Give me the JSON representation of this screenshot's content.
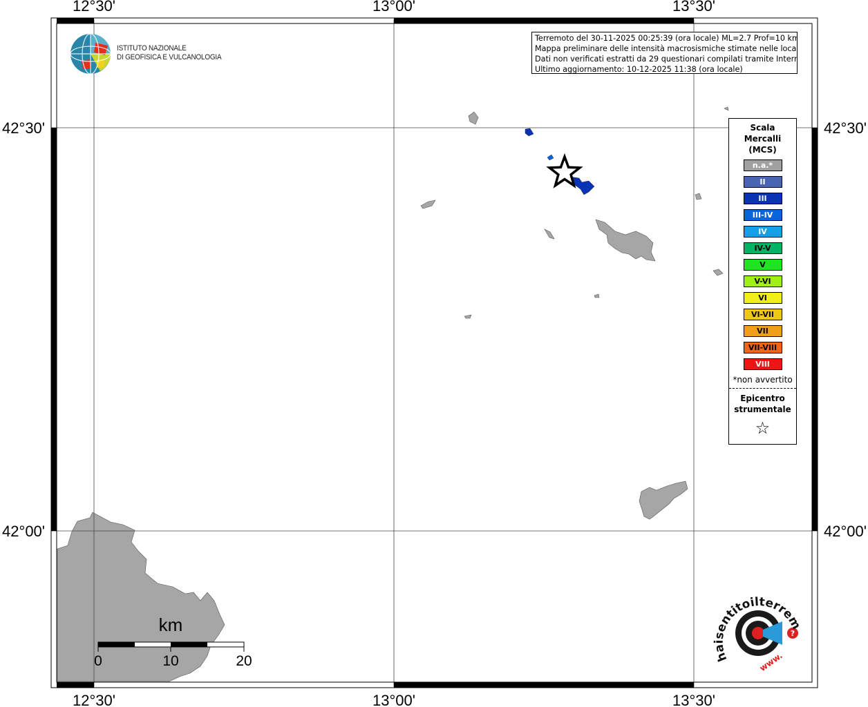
{
  "coords": {
    "top": [
      "12°30'",
      "13°00'",
      "13°30'"
    ],
    "bottom": [
      "12°30'",
      "13°00'",
      "13°30'"
    ],
    "left": [
      "42°30'",
      "42°00'"
    ],
    "right": [
      "42°30'",
      "42°00'"
    ]
  },
  "ingv": {
    "line1": "ISTITUTO NAZIONALE",
    "line2": "DI GEOFISICA E VULCANOLOGIA"
  },
  "info": {
    "line1": "Terremoto del 30-11-2025 00:25:39 (ora locale) ML=2.7 Prof=10 km",
    "line2": "Mappa preliminare delle intensità macrosismiche stimate nelle località",
    "line3": "Dati non verificati estratti da 29 questionari compilati tramite Internet.",
    "line4": "Ultimo aggiornamento: 10-12-2025 11:38 (ora locale)"
  },
  "legend": {
    "title1": "Scala",
    "title2": "Mercalli",
    "title3": "(MCS)",
    "items": [
      {
        "label": "n.a.*",
        "color": "#a0a0a0",
        "text": "#ffffff"
      },
      {
        "label": "II",
        "color": "#4a64b4",
        "text": "#ffffff"
      },
      {
        "label": "III",
        "color": "#0a32b4",
        "text": "#ffffff"
      },
      {
        "label": "III-IV",
        "color": "#0a64dc",
        "text": "#ffffff"
      },
      {
        "label": "IV",
        "color": "#14a0e6",
        "text": "#ffffff"
      },
      {
        "label": "IV-V",
        "color": "#00b464",
        "text": "#000000"
      },
      {
        "label": "V",
        "color": "#1ee61e",
        "text": "#000000"
      },
      {
        "label": "V-VI",
        "color": "#a0f014",
        "text": "#000000"
      },
      {
        "label": "VI",
        "color": "#f0f014",
        "text": "#000000"
      },
      {
        "label": "VI-VII",
        "color": "#f0c814",
        "text": "#000000"
      },
      {
        "label": "VII",
        "color": "#f0a014",
        "text": "#000000"
      },
      {
        "label": "VII-VIII",
        "color": "#f06414",
        "text": "#000000"
      },
      {
        "label": "VIII",
        "color": "#f01414",
        "text": "#ffffff"
      }
    ],
    "na_note": "*non avvertito",
    "epi1": "Epicentro",
    "epi2": "strumentale"
  },
  "scale": {
    "unit": "km",
    "ticks": [
      "0",
      "10",
      "20"
    ]
  },
  "brand": {
    "text": "haisentitoilterremoto.it",
    "www": "www."
  },
  "colors": {
    "land": "#a6a6a6",
    "intensity_blue": "#0a32b4",
    "intensity_light": "#0a64dc"
  }
}
